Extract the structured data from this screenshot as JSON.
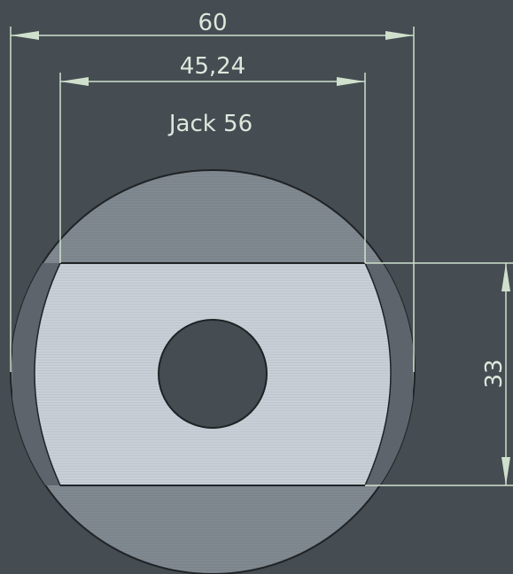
{
  "drawing": {
    "label": "Jack 56",
    "dimensions": {
      "outer_width": "60",
      "flat_width": "45,24",
      "flat_height": "33"
    }
  },
  "colors": {
    "background": "#454c52",
    "dimension_line": "#cfe0cc",
    "dimension_text": "#dfe7dc",
    "disc_outer": "#808890",
    "disc_rim": "#5d646b",
    "flat_face": "#c9cfd6",
    "outline": "#1f2326"
  }
}
